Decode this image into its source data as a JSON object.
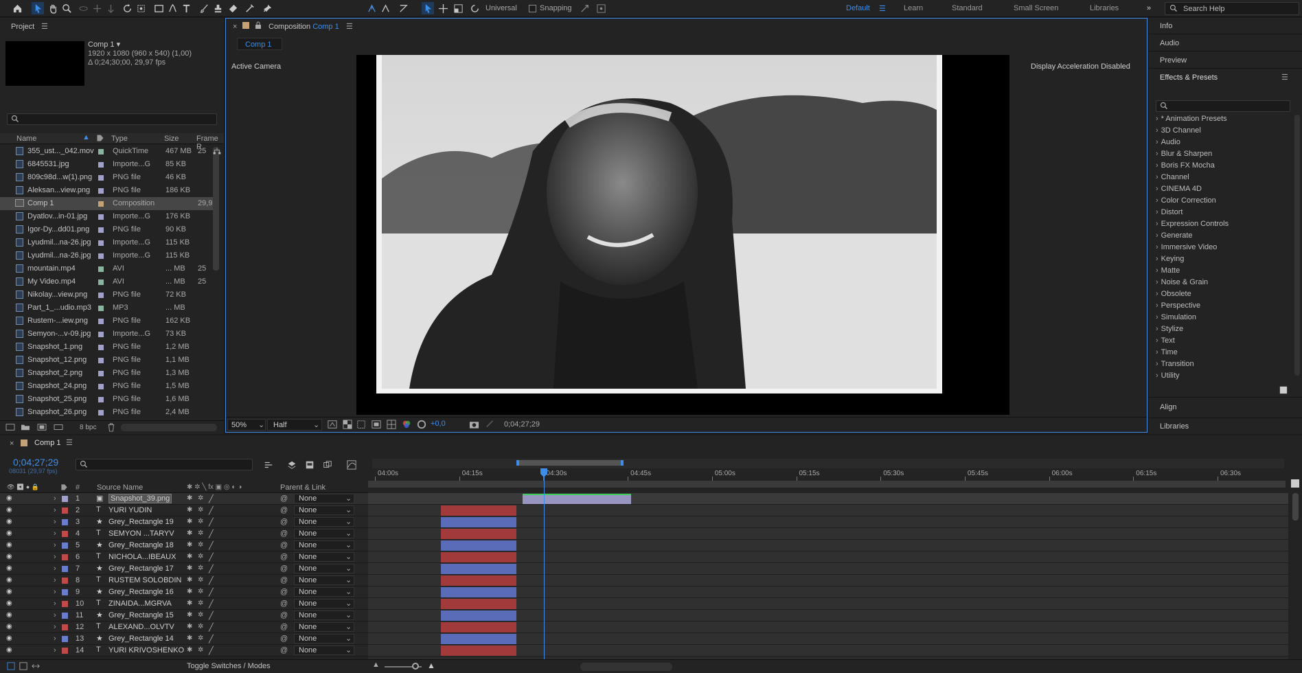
{
  "toolbar": {
    "universal": "Universal",
    "snapping": "Snapping",
    "workspaces": [
      "Default",
      "Learn",
      "Standard",
      "Small Screen",
      "Libraries"
    ],
    "search_help": "Search Help"
  },
  "project": {
    "title": "Project",
    "comp_name": "Comp 1",
    "comp_info1": "1920 x 1080  (960 x 540) (1,00)",
    "comp_info2": "Δ 0;24;30;00, 29,97 fps",
    "columns": [
      "Name",
      "Type",
      "Size",
      "Frame R"
    ],
    "items": [
      {
        "name": "355_ust..._042.mov",
        "type": "QuickTime",
        "size": "467 MB",
        "fr": "25",
        "color": "#8ab4a0"
      },
      {
        "name": "6845531.jpg",
        "type": "Importe...G",
        "size": "85 KB",
        "fr": "",
        "color": "#a0a0c8"
      },
      {
        "name": "809c98d...w(1).png",
        "type": "PNG file",
        "size": "46 KB",
        "fr": "",
        "color": "#a0a0c8"
      },
      {
        "name": "Aleksan...view.png",
        "type": "PNG file",
        "size": "186 KB",
        "fr": "",
        "color": "#a0a0c8"
      },
      {
        "name": "Comp 1",
        "type": "Composition",
        "size": "",
        "fr": "29,9",
        "color": "#c4a276"
      },
      {
        "name": "Dyatlov...in-01.jpg",
        "type": "Importe...G",
        "size": "176 KB",
        "fr": "",
        "color": "#a0a0c8"
      },
      {
        "name": "Igor-Dy...dd01.png",
        "type": "PNG file",
        "size": "90 KB",
        "fr": "",
        "color": "#a0a0c8"
      },
      {
        "name": "Lyudmil...na-26.jpg",
        "type": "Importe...G",
        "size": "115 KB",
        "fr": "",
        "color": "#a0a0c8"
      },
      {
        "name": "Lyudmil...na-26.jpg",
        "type": "Importe...G",
        "size": "115 KB",
        "fr": "",
        "color": "#a0a0c8"
      },
      {
        "name": "mountain.mp4",
        "type": "AVI",
        "size": "... MB",
        "fr": "25",
        "color": "#8ab4a0"
      },
      {
        "name": "My Video.mp4",
        "type": "AVI",
        "size": "... MB",
        "fr": "25",
        "color": "#8ab4a0"
      },
      {
        "name": "Nikolay...view.png",
        "type": "PNG file",
        "size": "72 KB",
        "fr": "",
        "color": "#a0a0c8"
      },
      {
        "name": "Part_1_...udio.mp3",
        "type": "MP3",
        "size": "... MB",
        "fr": "",
        "color": "#8ab4a0"
      },
      {
        "name": "Rustem-...iew.png",
        "type": "PNG file",
        "size": "162 KB",
        "fr": "",
        "color": "#a0a0c8"
      },
      {
        "name": "Semyon-...v-09.jpg",
        "type": "Importe...G",
        "size": "73 KB",
        "fr": "",
        "color": "#a0a0c8"
      },
      {
        "name": "Snapshot_1.png",
        "type": "PNG file",
        "size": "1,2 MB",
        "fr": "",
        "color": "#a0a0c8"
      },
      {
        "name": "Snapshot_12.png",
        "type": "PNG file",
        "size": "1,1 MB",
        "fr": "",
        "color": "#a0a0c8"
      },
      {
        "name": "Snapshot_2.png",
        "type": "PNG file",
        "size": "1,3 MB",
        "fr": "",
        "color": "#a0a0c8"
      },
      {
        "name": "Snapshot_24.png",
        "type": "PNG file",
        "size": "1,5 MB",
        "fr": "",
        "color": "#a0a0c8"
      },
      {
        "name": "Snapshot_25.png",
        "type": "PNG file",
        "size": "1,6 MB",
        "fr": "",
        "color": "#a0a0c8"
      },
      {
        "name": "Snapshot_26.png",
        "type": "PNG file",
        "size": "2,4 MB",
        "fr": "",
        "color": "#a0a0c8"
      }
    ],
    "bpc": "8 bpc"
  },
  "composition": {
    "tab_prefix": "Composition",
    "tab_name": "Comp 1",
    "subtab": "Comp 1",
    "active_camera": "Active Camera",
    "accel": "Display Acceleration Disabled",
    "zoom": "50%",
    "resolution": "Half",
    "exposure": "+0,0",
    "timecode": "0;04;27;29"
  },
  "right": {
    "info": "Info",
    "audio": "Audio",
    "preview": "Preview",
    "effects_title": "Effects & Presets",
    "effects": [
      "* Animation Presets",
      "3D Channel",
      "Audio",
      "Blur & Sharpen",
      "Boris FX Mocha",
      "Channel",
      "CINEMA 4D",
      "Color Correction",
      "Distort",
      "Expression Controls",
      "Generate",
      "Immersive Video",
      "Keying",
      "Matte",
      "Noise & Grain",
      "Obsolete",
      "Perspective",
      "Simulation",
      "Stylize",
      "Text",
      "Time",
      "Transition",
      "Utility"
    ],
    "align": "Align",
    "libraries": "Libraries"
  },
  "timeline": {
    "tab": "Comp 1",
    "timecode": "0;04;27;29",
    "frames": "08031 (29,97 fps)",
    "col_source": "Source Name",
    "col_parent": "Parent & Link",
    "ruler": [
      "04:00s",
      "04:15s",
      "04:30s",
      "04:45s",
      "05:00s",
      "05:15s",
      "05:30s",
      "05:45s",
      "06:00s",
      "06:15s",
      "06:30s"
    ],
    "toggle": "Toggle Switches / Modes",
    "layers": [
      {
        "n": "1",
        "name": "Snapshot_39.png",
        "kind": "img",
        "color": "#a0a0c8",
        "parent": "None"
      },
      {
        "n": "2",
        "name": "YURI YUDIN",
        "kind": "T",
        "color": "#c04a4a",
        "parent": "None"
      },
      {
        "n": "3",
        "name": "Grey_Rectangle 19",
        "kind": "star",
        "color": "#6a7dcc",
        "parent": "None"
      },
      {
        "n": "4",
        "name": "SEMYON ...TARYV",
        "kind": "T",
        "color": "#c04a4a",
        "parent": "None"
      },
      {
        "n": "5",
        "name": "Grey_Rectangle 18",
        "kind": "star",
        "color": "#6a7dcc",
        "parent": "None"
      },
      {
        "n": "6",
        "name": "NICHOLA...IBEAUX",
        "kind": "T",
        "color": "#c04a4a",
        "parent": "None"
      },
      {
        "n": "7",
        "name": "Grey_Rectangle 17",
        "kind": "star",
        "color": "#6a7dcc",
        "parent": "None"
      },
      {
        "n": "8",
        "name": "RUSTEM SOLOBDIN",
        "kind": "T",
        "color": "#c04a4a",
        "parent": "None"
      },
      {
        "n": "9",
        "name": "Grey_Rectangle 16",
        "kind": "star",
        "color": "#6a7dcc",
        "parent": "None"
      },
      {
        "n": "10",
        "name": "ZINAIDA...MGRVA",
        "kind": "T",
        "color": "#c04a4a",
        "parent": "None"
      },
      {
        "n": "11",
        "name": "Grey_Rectangle 15",
        "kind": "star",
        "color": "#6a7dcc",
        "parent": "None"
      },
      {
        "n": "12",
        "name": "ALEXAND...OLVTV",
        "kind": "T",
        "color": "#c04a4a",
        "parent": "None"
      },
      {
        "n": "13",
        "name": "Grey_Rectangle 14",
        "kind": "star",
        "color": "#6a7dcc",
        "parent": "None"
      },
      {
        "n": "14",
        "name": "YURI KRIVOSHENKO",
        "kind": "T",
        "color": "#c04a4a",
        "parent": "None"
      }
    ]
  }
}
